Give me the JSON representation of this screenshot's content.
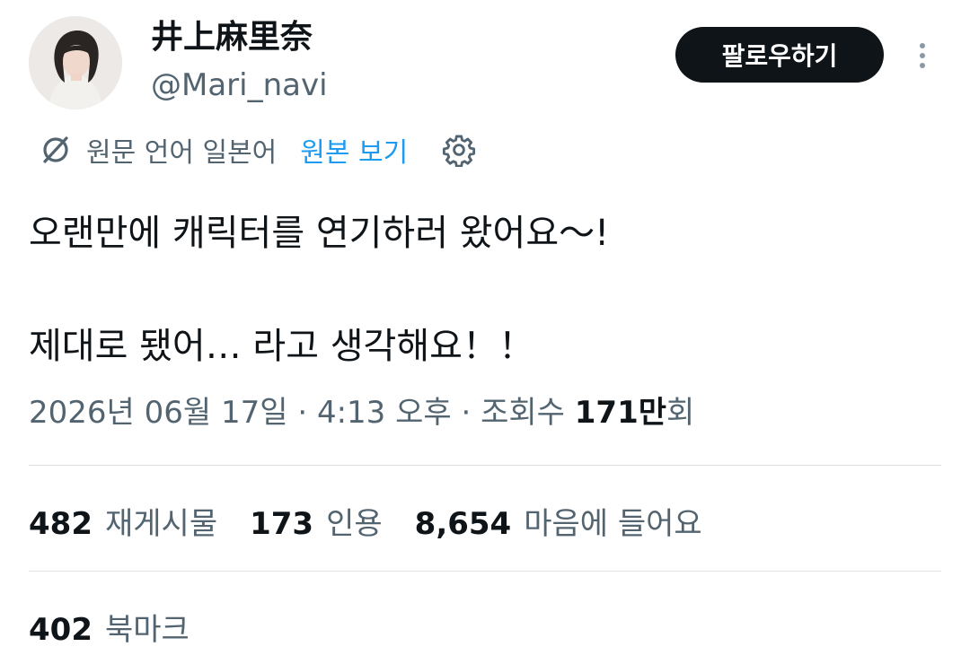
{
  "author": {
    "display_name": "井上麻里奈",
    "handle": "@Mari_navi"
  },
  "follow_button_label": "팔로우하기",
  "translation": {
    "source_language": "원문 언어 일본어",
    "show_original_label": "원본 보기"
  },
  "tweet": {
    "line1": "오랜만에 캐릭터를 연기하러 왔어요～!",
    "line2": "제대로 됐어… 라고 생각해요！！"
  },
  "meta": {
    "date": "2026년 06월 17일",
    "separator1": " · ",
    "time": "4:13 오후",
    "separator2": " · ",
    "views_label": "조회수 ",
    "views_count": "171만",
    "views_suffix": "회"
  },
  "stats": {
    "reposts": {
      "count": "482",
      "label": "재게시물"
    },
    "quotes": {
      "count": "173",
      "label": "인용"
    },
    "likes": {
      "count": "8,654",
      "label": "마음에 들어요"
    },
    "bookmarks": {
      "count": "402",
      "label": "북마크"
    }
  },
  "icons": {
    "translate": "translate-icon",
    "settings": "gear-icon",
    "more": "more-vertical-icon"
  }
}
